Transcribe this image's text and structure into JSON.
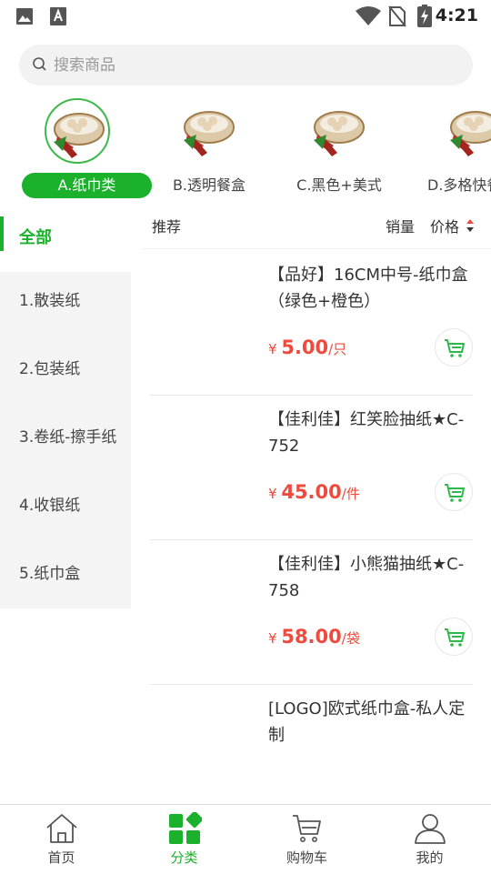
{
  "status_bar": {
    "time": "4:21"
  },
  "search": {
    "placeholder": "搜索商品"
  },
  "categories": [
    {
      "label": "A.纸巾类",
      "active": true
    },
    {
      "label": "B.透明餐盒",
      "active": false
    },
    {
      "label": "C.黑色+美式",
      "active": false
    },
    {
      "label": "D.多格快餐",
      "active": false
    }
  ],
  "sidebar": {
    "items": [
      {
        "label": "全部"
      },
      {
        "label": "1.散装纸"
      },
      {
        "label": "2.包装纸"
      },
      {
        "label": "3.卷纸-擦手纸"
      },
      {
        "label": "4.收银纸"
      },
      {
        "label": "5.纸巾盒"
      }
    ]
  },
  "sort": {
    "recommend": "推荐",
    "sales": "销量",
    "price": "价格"
  },
  "products": [
    {
      "name": "【品好】16CM中号-纸巾盒（绿色+橙色）",
      "currency": "¥",
      "price": "5.00",
      "unit": "/只"
    },
    {
      "name": "【佳利佳】红笑脸抽纸★C-752",
      "currency": "¥",
      "price": "45.00",
      "unit": "/件"
    },
    {
      "name": "【佳利佳】小熊猫抽纸★C-758",
      "currency": "¥",
      "price": "58.00",
      "unit": "/袋"
    },
    {
      "name": "[LOGO]欧式纸巾盒-私人定制",
      "currency": "",
      "price": "",
      "unit": ""
    }
  ],
  "tabbar": {
    "tabs": [
      {
        "label": "首页",
        "icon": "home-icon"
      },
      {
        "label": "分类",
        "icon": "category-icon"
      },
      {
        "label": "购物车",
        "icon": "cart-icon"
      },
      {
        "label": "我的",
        "icon": "user-icon"
      }
    ]
  },
  "colors": {
    "accent": "#1bb12c",
    "price": "#ee4a3d"
  }
}
